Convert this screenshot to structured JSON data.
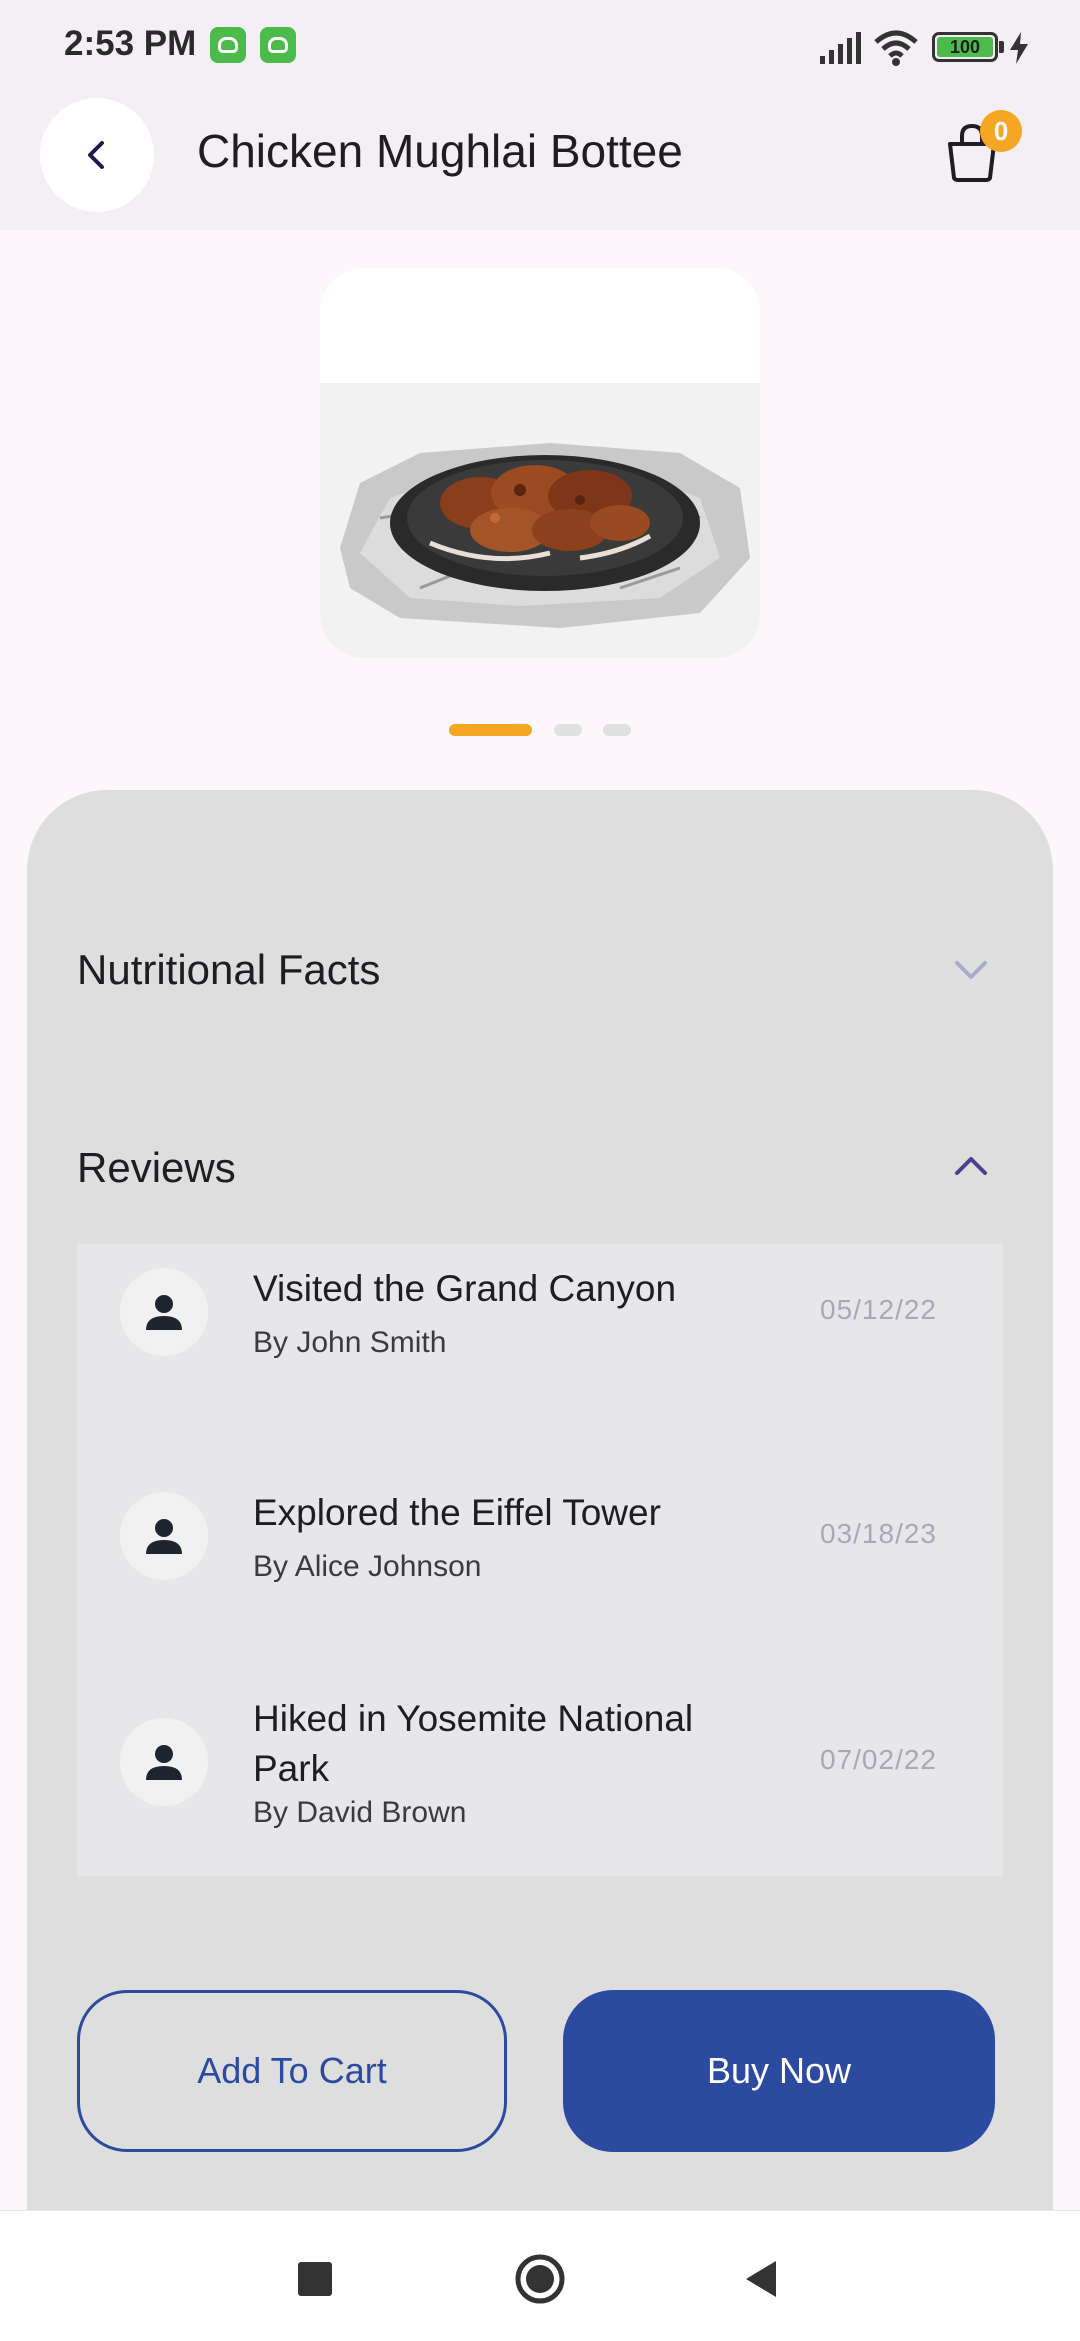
{
  "status_bar": {
    "time": "2:53 PM",
    "battery": "100",
    "icons": [
      "notification-app-icon",
      "notification-app-icon",
      "signal-icon",
      "wifi-icon",
      "battery-icon",
      "charging-icon"
    ]
  },
  "header": {
    "title": "Chicken Mughlai Bottee",
    "cart_count": "0",
    "icons": [
      "back-arrow-icon",
      "shopping-bag-icon"
    ]
  },
  "gallery": {
    "image": "grilled-chicken-sizzler-plate",
    "active_index": 0,
    "total": 3,
    "active_color": "#f5a623",
    "inactive_color": "#e0e0e0"
  },
  "sections": {
    "nutrition": {
      "label": "Nutritional Facts",
      "expanded": false
    },
    "reviews": {
      "label": "Reviews",
      "expanded": true
    }
  },
  "reviews": [
    {
      "title": "Visited the Grand Canyon",
      "author": "By John Smith",
      "date": "05/12/22"
    },
    {
      "title": "Explored the Eiffel Tower",
      "author": "By Alice Johnson",
      "date": "03/18/23"
    },
    {
      "title": "Hiked in Yosemite National Park",
      "author": "By David Brown",
      "date": "07/02/22"
    }
  ],
  "actions": {
    "add_to_cart": "Add To Cart",
    "buy_now": "Buy Now"
  },
  "colors": {
    "primary": "#2c4aa0",
    "accent": "#f5a623",
    "sheet": "#dedede"
  },
  "nav": {
    "icons": [
      "recent-apps-icon",
      "home-icon",
      "back-icon"
    ]
  }
}
